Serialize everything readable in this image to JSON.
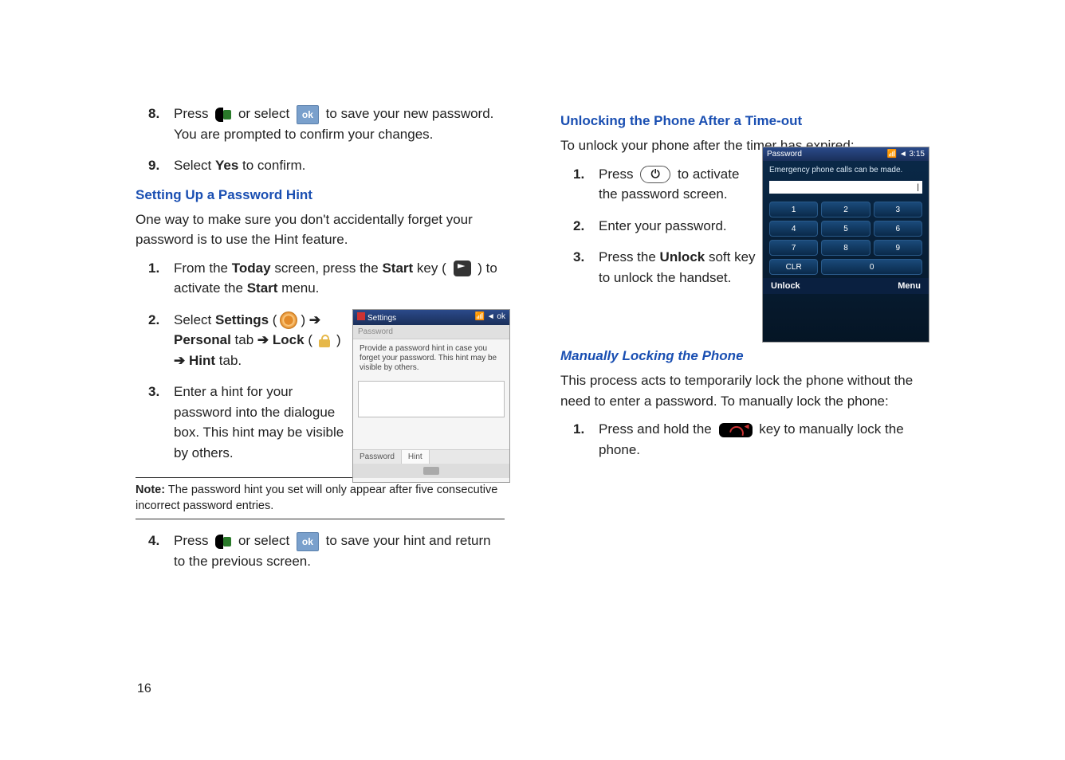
{
  "left": {
    "step8_part1": "Press",
    "step8_or": "or select",
    "step8_part2": "to save your new password. You are prompted to confirm your changes.",
    "step9_part1": "Select",
    "step9_yes": "Yes",
    "step9_part2": "to confirm.",
    "heading_hint": "Setting Up a Password Hint",
    "hint_intro": "One way to make sure you don't accidentally forget your password is to use the Hint feature.",
    "h_step1_a": "From the",
    "h_step1_today": "Today",
    "h_step1_b": "screen, press the",
    "h_step1_start": "Start",
    "h_step1_c": "key (",
    "h_step1_d": ") to activate the",
    "h_step1_startmenu": "Start",
    "h_step1_e": "menu.",
    "h_step2_a": "Select",
    "h_step2_settings": "Settings",
    "h_step2_personal": "Personal",
    "h_step2_tab": "tab",
    "h_step2_lock": "Lock",
    "h_step2_hint": "Hint",
    "h_step3": "Enter a hint for your password into the dialogue box. This hint may be visible by others.",
    "note_label": "Note:",
    "note_text": "The password hint you set will only appear after five consecutive incorrect password entries.",
    "h_step4_a": "Press",
    "h_step4_or": "or select",
    "h_step4_b": "to save your hint and return to the previous screen."
  },
  "right": {
    "heading_unlock": "Unlocking the Phone After a Time-out",
    "unlock_intro": "To unlock your phone after the timer has expired:",
    "u_step1_a": "Press",
    "u_step1_b": "to activate the password screen.",
    "u_step2": "Enter your password.",
    "u_step3_a": "Press the",
    "u_step3_unlock": "Unlock",
    "u_step3_b": "soft key to unlock the handset.",
    "heading_manual": "Manually Locking the Phone",
    "manual_intro": "This process acts to temporarily lock the phone without the need to enter a password. To manually lock the phone:",
    "m_step1_a": "Press and hold the",
    "m_step1_b": "key to manually lock the phone."
  },
  "shot_settings": {
    "title": "Settings",
    "subbar": "Password",
    "hintnote": "Provide a password hint in case you forget your password. This hint may be visible by others.",
    "tab1": "Password",
    "tab2": "Hint"
  },
  "shot_lock": {
    "title": "Password",
    "time": "3:15",
    "msg": "Emergency phone calls can be made.",
    "keys": [
      "1",
      "2",
      "3",
      "4",
      "5",
      "6",
      "7",
      "8",
      "9"
    ],
    "clr": "CLR",
    "zero": "0",
    "soft_left": "Unlock",
    "soft_right": "Menu"
  },
  "page_number": "16"
}
